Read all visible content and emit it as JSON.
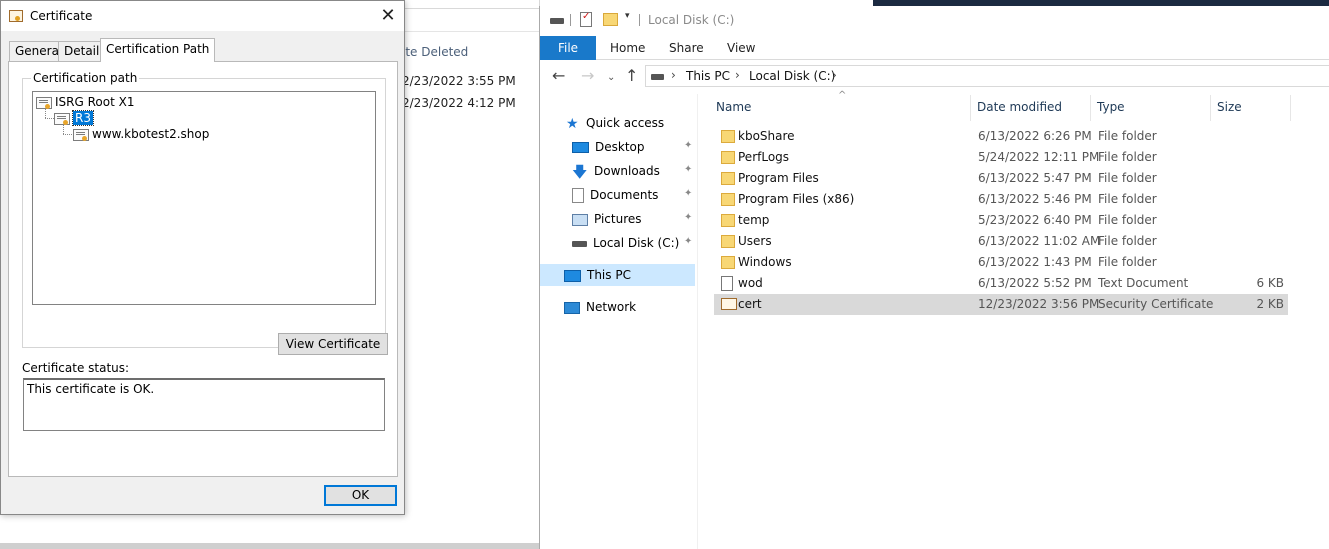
{
  "background_window": {
    "header": "ate Deleted",
    "dates": [
      "2/23/2022 3:55 PM",
      "2/23/2022 4:12 PM"
    ]
  },
  "certificate_dialog": {
    "title": "Certificate",
    "close_glyph": "✕",
    "tabs": [
      "General",
      "Details",
      "Certification Path"
    ],
    "active_tab": "Certification Path",
    "path_group_label": "Certification path",
    "tree": [
      {
        "label": "ISRG Root X1",
        "level": 0
      },
      {
        "label": "R3",
        "level": 1,
        "selected": true
      },
      {
        "label": "www.kbotest2.shop",
        "level": 2
      }
    ],
    "view_certificate_label": "View Certificate",
    "status_label": "Certificate status:",
    "status_text": "This certificate is OK.",
    "ok_label": "OK"
  },
  "explorer": {
    "window_title": "Local Disk (C:)",
    "qat_menu_glyph": "▾",
    "ribbon": {
      "file": "File",
      "tabs": [
        "Home",
        "Share",
        "View"
      ]
    },
    "nav_glyphs": {
      "back": "←",
      "forward": "→",
      "recent": "⌄",
      "up": "↑",
      "sort_up": "^",
      "pin": "✦",
      "star": "★",
      "download_arrow": "🡇"
    },
    "breadcrumb": [
      "This PC",
      "Local Disk (C:)"
    ],
    "breadcrumb_sep": "›",
    "nav_pane": [
      {
        "label": "Quick access",
        "icon": "star-icon"
      },
      {
        "label": "Desktop",
        "icon": "desktop-icon",
        "pinned": true
      },
      {
        "label": "Downloads",
        "icon": "downloads-icon",
        "pinned": true
      },
      {
        "label": "Documents",
        "icon": "documents-icon",
        "pinned": true
      },
      {
        "label": "Pictures",
        "icon": "pictures-icon",
        "pinned": true
      },
      {
        "label": "Local Disk (C:)",
        "icon": "drive-icon",
        "pinned": true
      },
      {
        "label": "This PC",
        "icon": "computer-icon",
        "selected": true
      },
      {
        "label": "Network",
        "icon": "network-icon"
      }
    ],
    "columns": [
      "Name",
      "Date modified",
      "Type",
      "Size"
    ],
    "files": [
      {
        "name": "kboShare",
        "date": "6/13/2022 6:26 PM",
        "type": "File folder",
        "size": "",
        "icon": "folder-icon"
      },
      {
        "name": "PerfLogs",
        "date": "5/24/2022 12:11 PM",
        "type": "File folder",
        "size": "",
        "icon": "folder-icon"
      },
      {
        "name": "Program Files",
        "date": "6/13/2022 5:47 PM",
        "type": "File folder",
        "size": "",
        "icon": "folder-icon"
      },
      {
        "name": "Program Files (x86)",
        "date": "6/13/2022 5:46 PM",
        "type": "File folder",
        "size": "",
        "icon": "folder-icon"
      },
      {
        "name": "temp",
        "date": "5/23/2022 6:40 PM",
        "type": "File folder",
        "size": "",
        "icon": "folder-icon"
      },
      {
        "name": "Users",
        "date": "6/13/2022 11:02 AM",
        "type": "File folder",
        "size": "",
        "icon": "folder-icon"
      },
      {
        "name": "Windows",
        "date": "6/13/2022 1:43 PM",
        "type": "File folder",
        "size": "",
        "icon": "folder-icon"
      },
      {
        "name": "wod",
        "date": "6/13/2022 5:52 PM",
        "type": "Text Document",
        "size": "6 KB",
        "icon": "text-document-icon"
      },
      {
        "name": "cert",
        "date": "12/23/2022 3:56 PM",
        "type": "Security Certificate",
        "size": "2 KB",
        "icon": "certificate-file-icon",
        "selected": true
      }
    ]
  },
  "colors": {
    "accent": "#0078d7",
    "file_tab": "#1979ca",
    "selection": "#cce8ff",
    "row_selected": "#d9d9d9",
    "folder": "#f8d775"
  }
}
